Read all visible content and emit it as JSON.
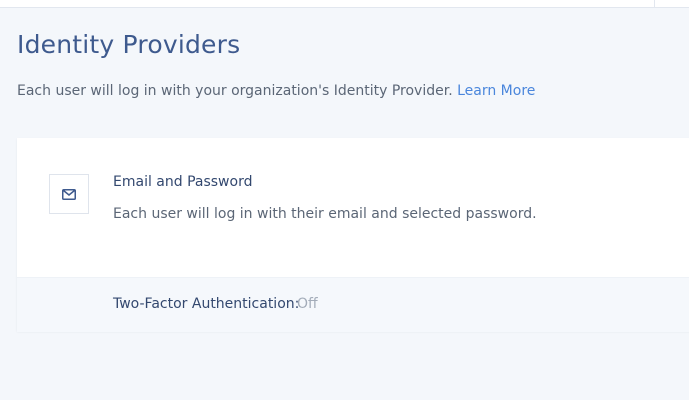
{
  "header": {
    "title": "Identity Providers",
    "subtitle": "Each user will log in with your organization's Identity Provider.",
    "learn_more_label": "Learn More"
  },
  "provider": {
    "icon": "envelope-icon",
    "name": "Email and Password",
    "description": "Each user will log in with their email and selected password.",
    "two_factor_label": "Two-Factor Authentication:",
    "two_factor_value": "Off"
  },
  "colors": {
    "title": "#3e5a8e",
    "link": "#4a86dc",
    "background": "#f4f7fb",
    "muted_value": "#a3acb9"
  }
}
